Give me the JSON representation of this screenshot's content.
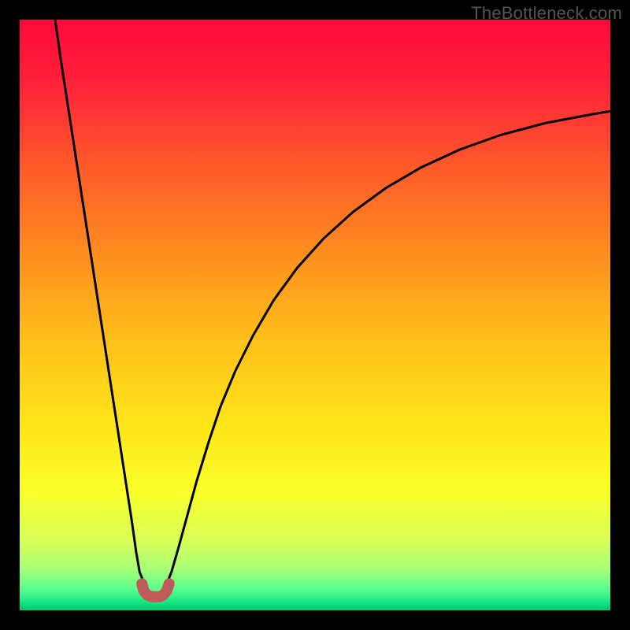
{
  "watermark": "TheBottleneck.com",
  "chart_data": {
    "type": "line",
    "title": "",
    "xlabel": "",
    "ylabel": "",
    "xlim": [
      0,
      100
    ],
    "ylim": [
      0,
      100
    ],
    "grid": false,
    "legend": false,
    "annotations": [],
    "background_gradient_stops": [
      {
        "offset": 0.0,
        "color": "#ff0a3a"
      },
      {
        "offset": 0.1,
        "color": "#ff1f3a"
      },
      {
        "offset": 0.25,
        "color": "#ff5a2a"
      },
      {
        "offset": 0.4,
        "color": "#ff8f1e"
      },
      {
        "offset": 0.55,
        "color": "#ffc21a"
      },
      {
        "offset": 0.7,
        "color": "#ffe81a"
      },
      {
        "offset": 0.8,
        "color": "#f9ff2a"
      },
      {
        "offset": 0.88,
        "color": "#d9ff55"
      },
      {
        "offset": 0.93,
        "color": "#a8ff78"
      },
      {
        "offset": 0.965,
        "color": "#58ff90"
      },
      {
        "offset": 0.985,
        "color": "#18e882"
      },
      {
        "offset": 1.0,
        "color": "#00c86e"
      }
    ],
    "series": [
      {
        "name": "left-branch",
        "stroke": "#000000",
        "stroke_width": 3,
        "x": [
          6,
          7,
          8,
          9,
          10,
          11,
          12,
          13,
          14,
          15,
          16,
          17,
          18,
          19,
          19.7,
          20.3,
          21.5,
          22.3
        ],
        "y": [
          100,
          93,
          86.5,
          80,
          73.5,
          67,
          60.5,
          54,
          47.5,
          41,
          34.5,
          28,
          21.5,
          15,
          10,
          6.5,
          3.5,
          3
        ]
      },
      {
        "name": "right-branch",
        "stroke": "#000000",
        "stroke_width": 3,
        "x": [
          23.7,
          24.5,
          25.7,
          27,
          28.5,
          30,
          32,
          34,
          36.5,
          39.5,
          43,
          47,
          51.5,
          56.5,
          62,
          68,
          74.5,
          81.5,
          89,
          97,
          100
        ],
        "y": [
          3,
          3.5,
          6.5,
          11,
          16.5,
          22,
          28.5,
          34.5,
          40.5,
          46.5,
          52.5,
          58,
          63,
          67.5,
          71.5,
          75,
          78,
          80.5,
          82.5,
          84,
          84.5
        ]
      },
      {
        "name": "trough-marker",
        "stroke": "#c05a5a",
        "stroke_width": 14,
        "linecap": "round",
        "x": [
          20.7,
          21.0,
          21.6,
          22.3,
          23.0,
          23.7,
          24.3,
          24.9,
          25.3
        ],
        "y": [
          4.5,
          3.3,
          2.6,
          2.3,
          2.3,
          2.3,
          2.6,
          3.3,
          4.5
        ]
      }
    ]
  }
}
